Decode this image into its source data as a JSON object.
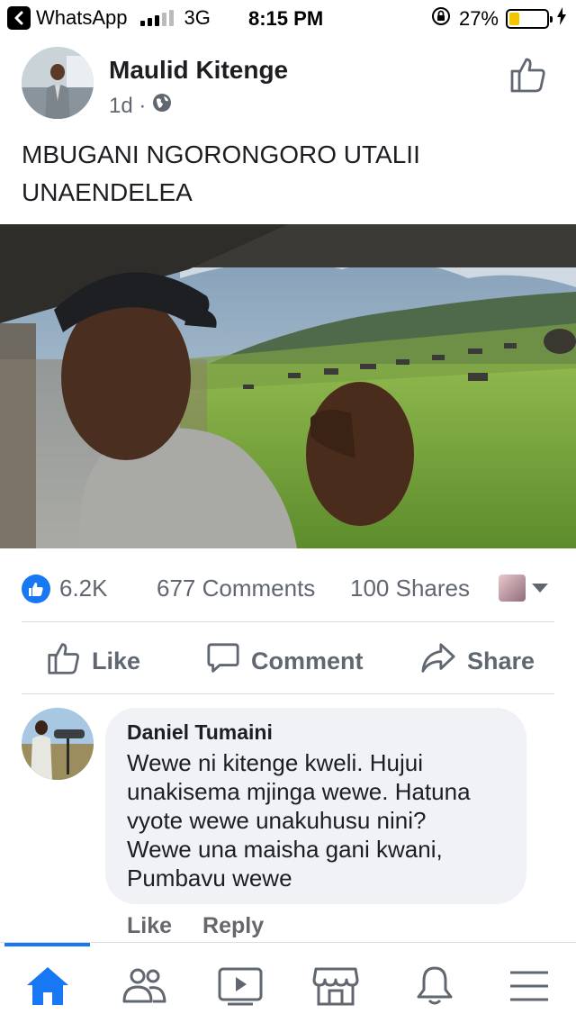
{
  "status_bar": {
    "back_app": "WhatsApp",
    "network": "3G",
    "time": "8:15 PM",
    "battery_percent": "27%",
    "battery_level": 0.27,
    "icons": [
      "back-chevron-icon",
      "signal-icon",
      "orientation-lock-icon",
      "battery-icon",
      "charging-icon"
    ]
  },
  "post": {
    "author": "Maulid Kitenge",
    "time_ago": "1d ·",
    "privacy_icon": "globe-icon",
    "text_line1": "MBUGANI NGORONGORO UTALII",
    "text_line2": "UNAENDELEA"
  },
  "stats": {
    "likes": "6.2K",
    "comments": "677 Comments",
    "shares": "100 Shares"
  },
  "actions": {
    "like": "Like",
    "comment": "Comment",
    "share": "Share"
  },
  "comment": {
    "author": "Daniel Tumaini",
    "lines": [
      "Wewe ni kitenge kweli. Hujui",
      "unakisema mjinga wewe. Hatuna",
      "vyote wewe unakuhusu nini?",
      "Wewe una maisha gani kwani,",
      "Pumbavu wewe"
    ],
    "like_label": "Like",
    "reply_label": "Reply"
  },
  "tabbar": {
    "tabs": [
      "home-icon",
      "friends-icon",
      "watch-icon",
      "marketplace-icon",
      "notifications-icon",
      "menu-icon"
    ],
    "active": "home-icon"
  },
  "colors": {
    "accent": "#1877f2",
    "text": "#1c1e21",
    "secondary_text": "#606770",
    "bubble": "#f0f2f5",
    "battery": "#f5c400"
  }
}
